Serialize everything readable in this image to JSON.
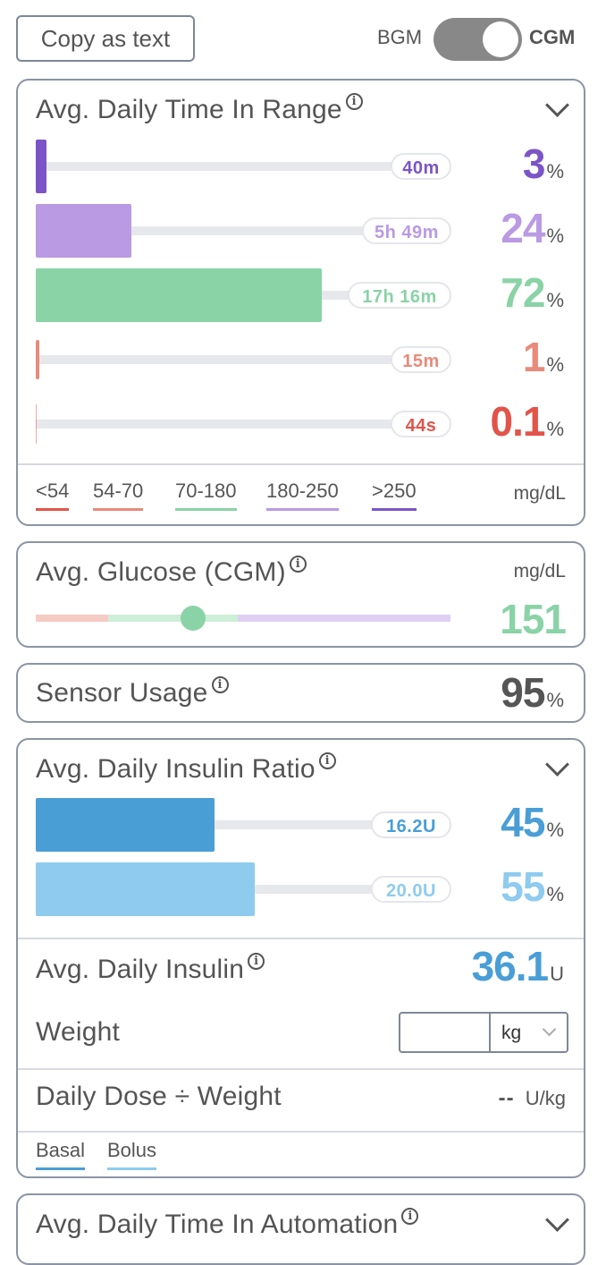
{
  "toolbar": {
    "copy_label": "Copy as text",
    "toggle_left": "BGM",
    "toggle_right": "CGM",
    "toggle_state": "CGM"
  },
  "time_in_range": {
    "title": "Avg. Daily Time In Range",
    "rows": [
      {
        "range": ">250",
        "duration": "40m",
        "percent": "3",
        "fraction": 0.03,
        "color": "#7b55c7"
      },
      {
        "range": "180-250",
        "duration": "5h 49m",
        "percent": "24",
        "fraction": 0.24,
        "color": "#b99ae3"
      },
      {
        "range": "70-180",
        "duration": "17h 16m",
        "percent": "72",
        "fraction": 0.72,
        "color": "#8ad3a6"
      },
      {
        "range": "54-70",
        "duration": "15m",
        "percent": "1",
        "fraction": 0.01,
        "color": "#e98a7a"
      },
      {
        "range": "<54",
        "duration": "44s",
        "percent": "0.1",
        "fraction": 0.001,
        "color": "#e2544a"
      }
    ],
    "percent_unit": "%",
    "legend": [
      {
        "label": "<54",
        "color": "#e2544a"
      },
      {
        "label": "54-70",
        "color": "#e98a7a"
      },
      {
        "label": "70-180",
        "color": "#8ad3a6"
      },
      {
        "label": "180-250",
        "color": "#b99ae3"
      },
      {
        "label": ">250",
        "color": "#7b55c7"
      }
    ],
    "units": "mg/dL"
  },
  "avg_glucose": {
    "title": "Avg. Glucose (CGM)",
    "units": "mg/dL",
    "value": "151",
    "color": "#8ad3a6"
  },
  "sensor_usage": {
    "title": "Sensor Usage",
    "value": "95",
    "unit": "%"
  },
  "insulin_ratio": {
    "title": "Avg. Daily Insulin Ratio",
    "rows": [
      {
        "name": "Basal",
        "amount": "16.2U",
        "percent": "45",
        "fraction": 0.45,
        "color": "#4a9ed6"
      },
      {
        "name": "Bolus",
        "amount": "20.0U",
        "percent": "55",
        "fraction": 0.55,
        "color": "#8ecbef"
      }
    ],
    "percent_unit": "%",
    "avg_daily_insulin_label": "Avg. Daily Insulin",
    "avg_daily_insulin_value": "36.1",
    "avg_daily_insulin_unit": "U",
    "weight_label": "Weight",
    "weight_value": "",
    "weight_unit": "kg",
    "dose_label": "Daily Dose ÷ Weight",
    "dose_value": "--",
    "dose_unit": "U/kg",
    "legend": [
      {
        "label": "Basal",
        "color": "#4a9ed6"
      },
      {
        "label": "Bolus",
        "color": "#8ecbef"
      }
    ]
  },
  "automation": {
    "title": "Avg. Daily Time In Automation"
  }
}
